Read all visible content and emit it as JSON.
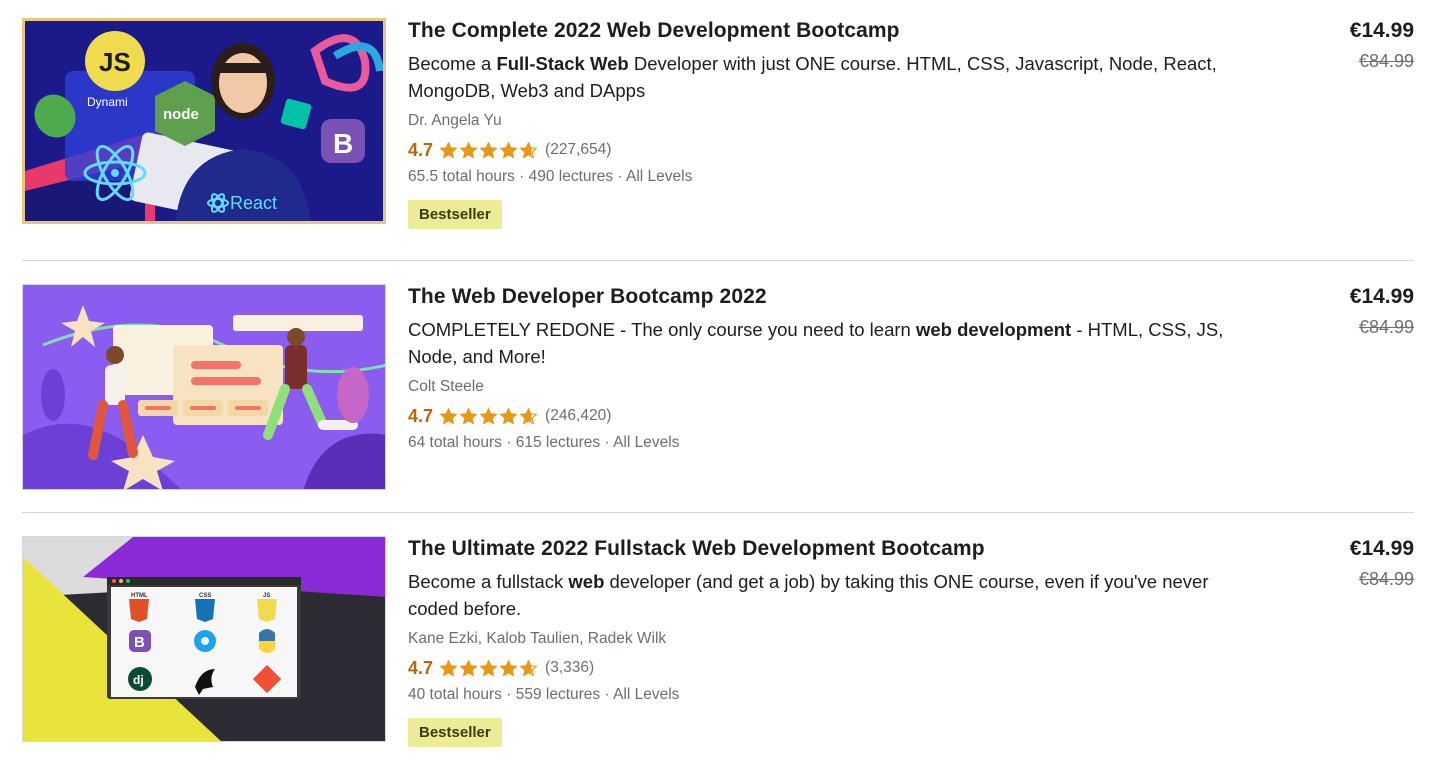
{
  "courses": [
    {
      "title": "The Complete 2022 Web Development Bootcamp",
      "desc_pre": "Become a ",
      "desc_bold": "Full-Stack Web",
      "desc_post": " Developer with just ONE course. HTML, CSS, Javascript, Node, React, MongoDB, Web3 and DApps",
      "author": "Dr. Angela Yu",
      "rating": "4.7",
      "rating_value": 4.7,
      "reviews": "(227,654)",
      "hours": "65.5 total hours",
      "lectures": "490 lectures",
      "level": "All Levels",
      "badge": "Bestseller",
      "price": "€14.99",
      "original_price": "€84.99",
      "thumb_labels": {
        "js": "JS",
        "node": "node",
        "react": "React",
        "b": "B",
        "dyn": "Dynami"
      }
    },
    {
      "title": "The Web Developer Bootcamp 2022",
      "desc_pre": "COMPLETELY REDONE - The only course you need to learn ",
      "desc_bold": "web development",
      "desc_post": " - HTML, CSS, JS, Node, and More!",
      "author": "Colt Steele",
      "rating": "4.7",
      "rating_value": 4.7,
      "reviews": "(246,420)",
      "hours": "64 total hours",
      "lectures": "615 lectures",
      "level": "All Levels",
      "badge": "",
      "price": "€14.99",
      "original_price": "€84.99"
    },
    {
      "title": "The Ultimate 2022 Fullstack Web Development Bootcamp",
      "desc_pre": "Become a fullstack ",
      "desc_bold": "web",
      "desc_post": " developer (and get a job) by taking this ONE course, even if you've never coded before.",
      "author": "Kane Ezki, Kalob Taulien, Radek Wilk",
      "rating": "4.7",
      "rating_value": 4.7,
      "reviews": "(3,336)",
      "hours": "40 total hours",
      "lectures": "559 lectures",
      "level": "All Levels",
      "badge": "Bestseller",
      "price": "€14.99",
      "original_price": "€84.99",
      "thumb_labels": {
        "html": "HTML",
        "css": "CSS",
        "js": "JS",
        "dj": "dj",
        "b": "B"
      }
    }
  ],
  "separator": " · ",
  "colors": {
    "rating": "#b4690e",
    "star": "#e59819",
    "badge_bg": "#eceb98",
    "badge_text": "#3d3c0a",
    "muted": "#6a6f73"
  }
}
